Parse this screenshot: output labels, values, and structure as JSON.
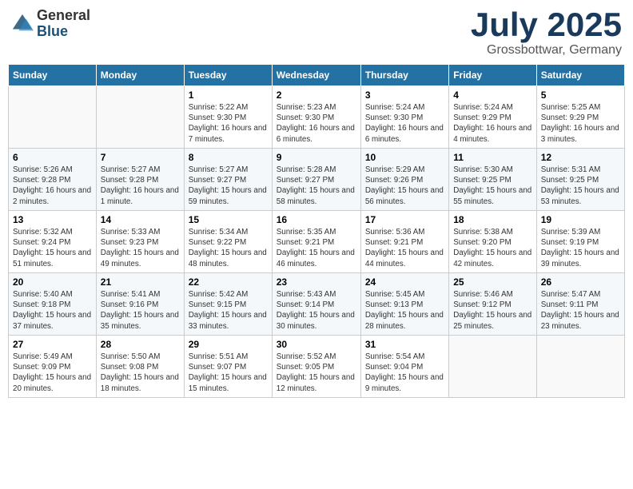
{
  "header": {
    "logo_general": "General",
    "logo_blue": "Blue",
    "month_title": "July 2025",
    "location": "Grossbottwar, Germany"
  },
  "weekdays": [
    "Sunday",
    "Monday",
    "Tuesday",
    "Wednesday",
    "Thursday",
    "Friday",
    "Saturday"
  ],
  "weeks": [
    [
      {
        "day": "",
        "info": ""
      },
      {
        "day": "",
        "info": ""
      },
      {
        "day": "1",
        "info": "Sunrise: 5:22 AM\nSunset: 9:30 PM\nDaylight: 16 hours and 7 minutes."
      },
      {
        "day": "2",
        "info": "Sunrise: 5:23 AM\nSunset: 9:30 PM\nDaylight: 16 hours and 6 minutes."
      },
      {
        "day": "3",
        "info": "Sunrise: 5:24 AM\nSunset: 9:30 PM\nDaylight: 16 hours and 6 minutes."
      },
      {
        "day": "4",
        "info": "Sunrise: 5:24 AM\nSunset: 9:29 PM\nDaylight: 16 hours and 4 minutes."
      },
      {
        "day": "5",
        "info": "Sunrise: 5:25 AM\nSunset: 9:29 PM\nDaylight: 16 hours and 3 minutes."
      }
    ],
    [
      {
        "day": "6",
        "info": "Sunrise: 5:26 AM\nSunset: 9:28 PM\nDaylight: 16 hours and 2 minutes."
      },
      {
        "day": "7",
        "info": "Sunrise: 5:27 AM\nSunset: 9:28 PM\nDaylight: 16 hours and 1 minute."
      },
      {
        "day": "8",
        "info": "Sunrise: 5:27 AM\nSunset: 9:27 PM\nDaylight: 15 hours and 59 minutes."
      },
      {
        "day": "9",
        "info": "Sunrise: 5:28 AM\nSunset: 9:27 PM\nDaylight: 15 hours and 58 minutes."
      },
      {
        "day": "10",
        "info": "Sunrise: 5:29 AM\nSunset: 9:26 PM\nDaylight: 15 hours and 56 minutes."
      },
      {
        "day": "11",
        "info": "Sunrise: 5:30 AM\nSunset: 9:25 PM\nDaylight: 15 hours and 55 minutes."
      },
      {
        "day": "12",
        "info": "Sunrise: 5:31 AM\nSunset: 9:25 PM\nDaylight: 15 hours and 53 minutes."
      }
    ],
    [
      {
        "day": "13",
        "info": "Sunrise: 5:32 AM\nSunset: 9:24 PM\nDaylight: 15 hours and 51 minutes."
      },
      {
        "day": "14",
        "info": "Sunrise: 5:33 AM\nSunset: 9:23 PM\nDaylight: 15 hours and 49 minutes."
      },
      {
        "day": "15",
        "info": "Sunrise: 5:34 AM\nSunset: 9:22 PM\nDaylight: 15 hours and 48 minutes."
      },
      {
        "day": "16",
        "info": "Sunrise: 5:35 AM\nSunset: 9:21 PM\nDaylight: 15 hours and 46 minutes."
      },
      {
        "day": "17",
        "info": "Sunrise: 5:36 AM\nSunset: 9:21 PM\nDaylight: 15 hours and 44 minutes."
      },
      {
        "day": "18",
        "info": "Sunrise: 5:38 AM\nSunset: 9:20 PM\nDaylight: 15 hours and 42 minutes."
      },
      {
        "day": "19",
        "info": "Sunrise: 5:39 AM\nSunset: 9:19 PM\nDaylight: 15 hours and 39 minutes."
      }
    ],
    [
      {
        "day": "20",
        "info": "Sunrise: 5:40 AM\nSunset: 9:18 PM\nDaylight: 15 hours and 37 minutes."
      },
      {
        "day": "21",
        "info": "Sunrise: 5:41 AM\nSunset: 9:16 PM\nDaylight: 15 hours and 35 minutes."
      },
      {
        "day": "22",
        "info": "Sunrise: 5:42 AM\nSunset: 9:15 PM\nDaylight: 15 hours and 33 minutes."
      },
      {
        "day": "23",
        "info": "Sunrise: 5:43 AM\nSunset: 9:14 PM\nDaylight: 15 hours and 30 minutes."
      },
      {
        "day": "24",
        "info": "Sunrise: 5:45 AM\nSunset: 9:13 PM\nDaylight: 15 hours and 28 minutes."
      },
      {
        "day": "25",
        "info": "Sunrise: 5:46 AM\nSunset: 9:12 PM\nDaylight: 15 hours and 25 minutes."
      },
      {
        "day": "26",
        "info": "Sunrise: 5:47 AM\nSunset: 9:11 PM\nDaylight: 15 hours and 23 minutes."
      }
    ],
    [
      {
        "day": "27",
        "info": "Sunrise: 5:49 AM\nSunset: 9:09 PM\nDaylight: 15 hours and 20 minutes."
      },
      {
        "day": "28",
        "info": "Sunrise: 5:50 AM\nSunset: 9:08 PM\nDaylight: 15 hours and 18 minutes."
      },
      {
        "day": "29",
        "info": "Sunrise: 5:51 AM\nSunset: 9:07 PM\nDaylight: 15 hours and 15 minutes."
      },
      {
        "day": "30",
        "info": "Sunrise: 5:52 AM\nSunset: 9:05 PM\nDaylight: 15 hours and 12 minutes."
      },
      {
        "day": "31",
        "info": "Sunrise: 5:54 AM\nSunset: 9:04 PM\nDaylight: 15 hours and 9 minutes."
      },
      {
        "day": "",
        "info": ""
      },
      {
        "day": "",
        "info": ""
      }
    ]
  ]
}
